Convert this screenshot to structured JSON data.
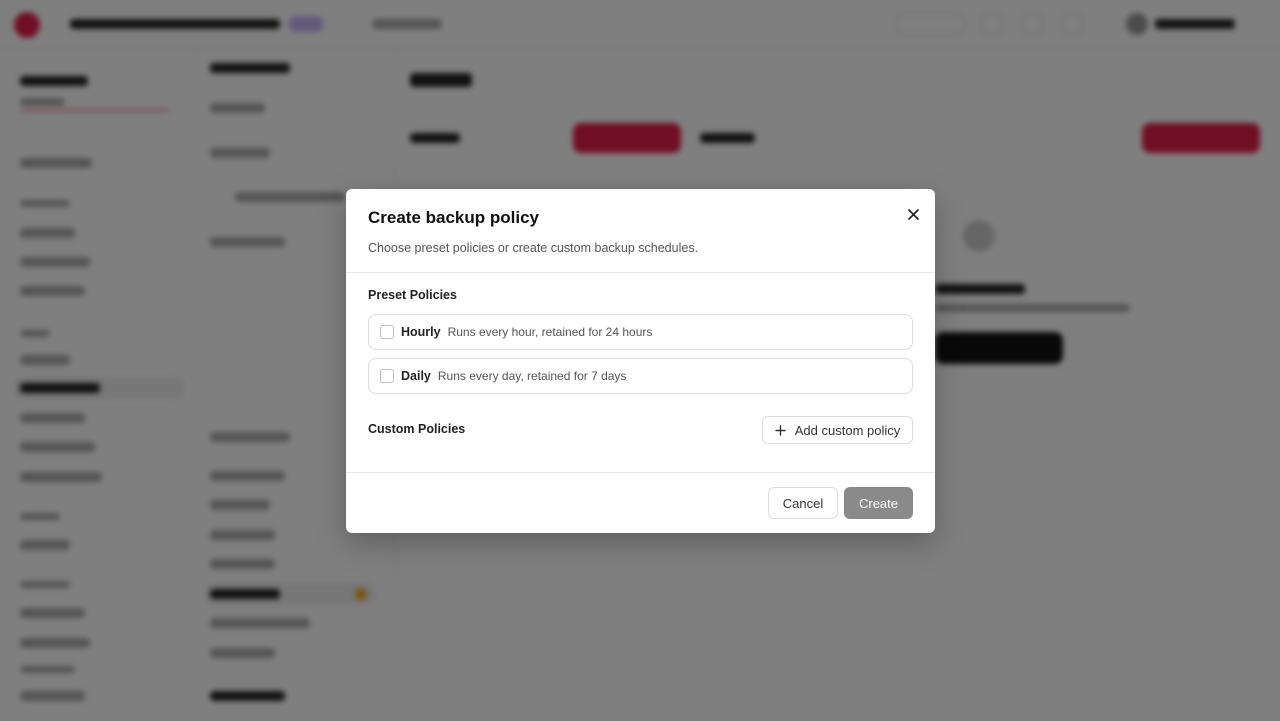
{
  "modal": {
    "title": "Create backup policy",
    "description": "Choose preset policies or create custom backup schedules.",
    "preset_section_label": "Preset Policies",
    "preset_policies": [
      {
        "name": "Hourly",
        "description": "Runs every hour, retained for 24 hours",
        "checked": false
      },
      {
        "name": "Daily",
        "description": "Runs every day, retained for 7 days",
        "checked": false
      }
    ],
    "custom_section_label": "Custom Policies",
    "add_custom_label": "Add custom policy",
    "cancel_label": "Cancel",
    "create_label": "Create"
  },
  "colors": {
    "brand_accent": "#e11d48",
    "create_button_disabled": "#8a8a8a",
    "overlay": "rgba(0,0,0,0.5)"
  },
  "icons": {
    "close": "close-icon",
    "add": "plus-icon"
  }
}
